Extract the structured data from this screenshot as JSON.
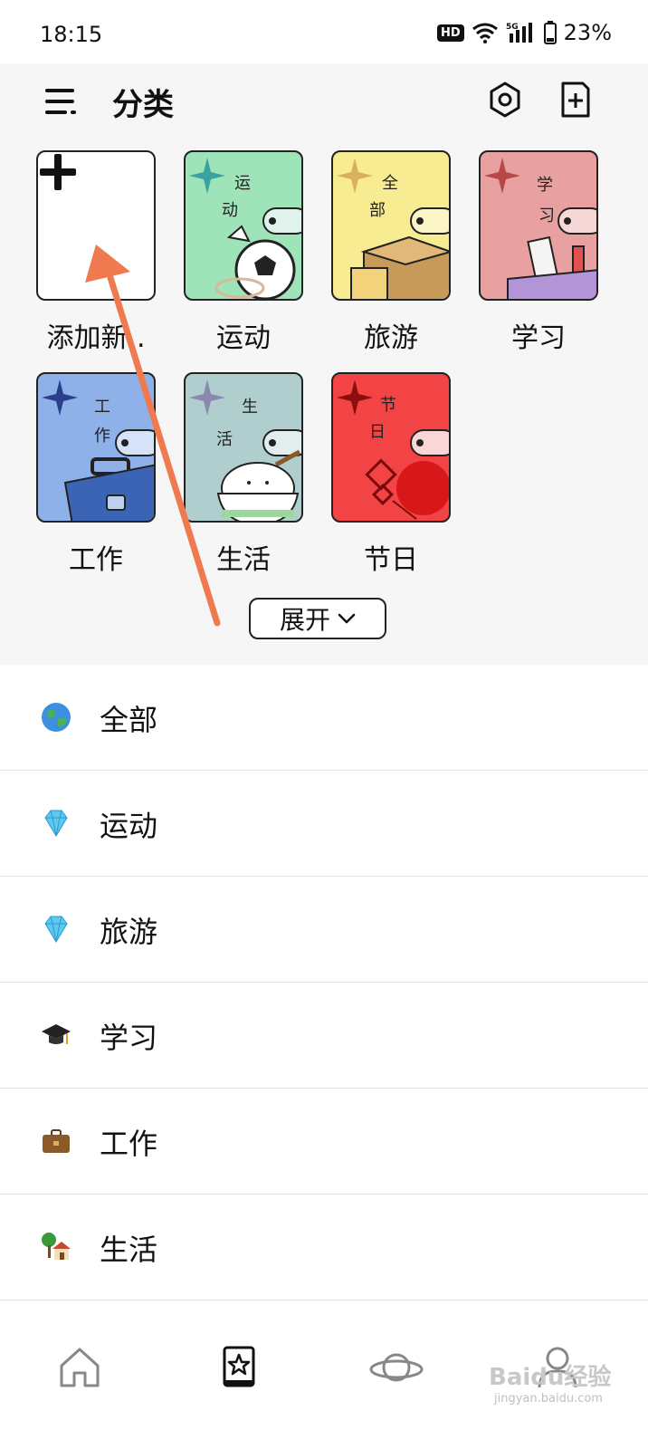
{
  "status_bar": {
    "time": "18:15",
    "hd_badge": "HD",
    "network": "5G",
    "battery": "23%"
  },
  "header": {
    "title": "分类"
  },
  "categories": [
    {
      "label": "添加新..",
      "cover_text": "",
      "color": "#ffffff",
      "icon": "plus-icon"
    },
    {
      "label": "运动",
      "cover_text": "运动",
      "color": "#9fe3b8",
      "icon": "soccer-ball-icon"
    },
    {
      "label": "旅游",
      "cover_text": "全部",
      "color": "#f8ec92",
      "icon": "box-icon"
    },
    {
      "label": "学习",
      "cover_text": "学习",
      "color": "#e8a0a0",
      "icon": "ruler-icon"
    },
    {
      "label": "工作",
      "cover_text": "工作",
      "color": "#8fb1ea",
      "icon": "briefcase-icon"
    },
    {
      "label": "生活",
      "cover_text": "生活",
      "color": "#b0cece",
      "icon": "rice-bowl-icon"
    },
    {
      "label": "节日",
      "cover_text": "节日",
      "color": "#f24444",
      "icon": "chinese-knot-icon"
    }
  ],
  "expand_button": {
    "label": "展开"
  },
  "list": [
    {
      "label": "全部",
      "icon": "globe-icon"
    },
    {
      "label": "运动",
      "icon": "gem-icon"
    },
    {
      "label": "旅游",
      "icon": "gem-icon"
    },
    {
      "label": "学习",
      "icon": "graduation-cap-icon"
    },
    {
      "label": "工作",
      "icon": "briefcase-icon"
    },
    {
      "label": "生活",
      "icon": "house-tree-icon"
    }
  ],
  "bottom_nav": [
    {
      "name": "home-icon"
    },
    {
      "name": "book-star-icon"
    },
    {
      "name": "planet-icon"
    },
    {
      "name": "user-icon"
    }
  ],
  "watermark": {
    "brand": "Baidu经验",
    "url": "jingyan.baidu.com"
  },
  "colors": {
    "panel_bg": "#f6f6f6",
    "arrow": "#f07a50"
  }
}
